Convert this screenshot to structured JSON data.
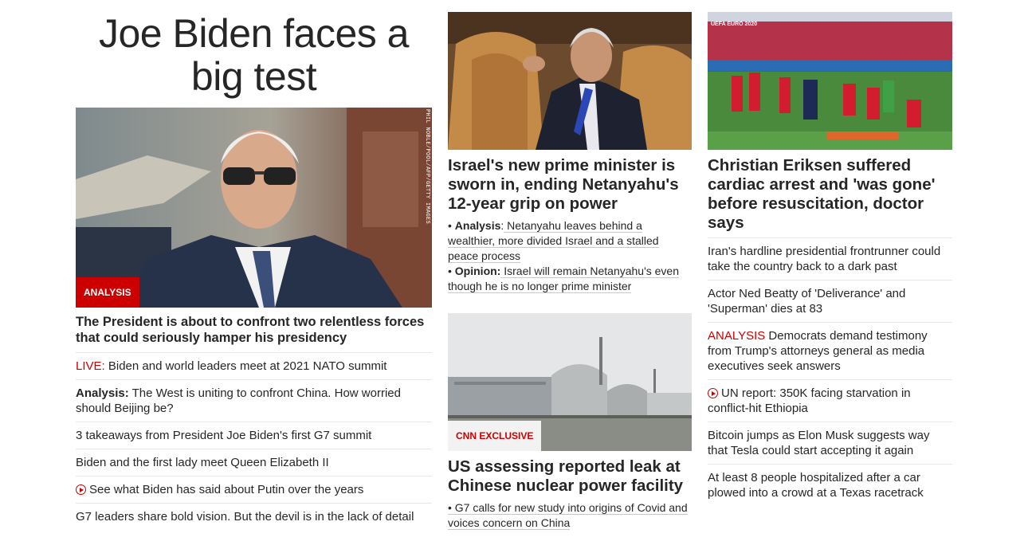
{
  "col1": {
    "big_headline": "Joe Biden faces a big test",
    "image_badge": "ANALYSIS",
    "image_credit": "PHIL NOBLE/POOL/AFP/GETTY IMAGES",
    "lead": "The President is about to confront two relentless forces that could seriously hamper his presidency",
    "items": [
      {
        "kicker": "LIVE:",
        "text": " Biden and world leaders meet at 2021 NATO summit"
      },
      {
        "kicker": "Analysis:",
        "text": " The West is uniting to confront China. How worried should Beijing be?"
      },
      {
        "text": "3 takeaways from President Joe Biden's first G7 summit"
      },
      {
        "text": "Biden and the first lady meet Queen Elizabeth II"
      },
      {
        "text": "See what Biden has said about Putin over the years"
      },
      {
        "text": "G7 leaders share bold vision. But the devil is in the lack of detail"
      }
    ]
  },
  "col2": {
    "story1_headline": "Israel's new prime minister is sworn in, ending Netanyahu's 12-year grip on power",
    "story1_bullets": [
      {
        "label": "Analysis",
        "sep": ":",
        "text": " Netanyahu leaves behind a wealthier, more divided Israel and a stalled peace process"
      },
      {
        "label": "Opinion:",
        "sep": "",
        "text": " Israel will remain Netanyahu's even though he is no longer prime minister"
      }
    ],
    "story2_badge": "CNN EXCLUSIVE",
    "story2_headline": "US assessing reported leak at Chinese nuclear power facility",
    "story2_bullet": "• G7 calls for new study into origins of Covid and voices concern on China"
  },
  "col3": {
    "image_text": "UEFA EURO 2020",
    "headline": "Christian Eriksen suffered cardiac arrest and 'was gone' before resuscitation, doctor says",
    "items": [
      {
        "text": "Iran's hardline presidential frontrunner could take the country back to a dark past"
      },
      {
        "text": "Actor Ned Beatty of 'Deliverance' and 'Superman' dies at 83"
      },
      {
        "kicker": "ANALYSIS",
        "text": " Democrats demand testimony from Trump's attorneys general as media executives seek answers"
      },
      {
        "text": "UN report: 350K facing starvation in conflict-hit Ethiopia"
      },
      {
        "text": "Bitcoin jumps as Elon Musk suggests way that Tesla could start accepting it again"
      },
      {
        "text": "At least 8 people hospitalized after a car plowed into a crowd at a Texas racetrack"
      }
    ]
  },
  "colors": {
    "accent": "#cc0000",
    "text": "#262626",
    "divider": "#e6e6e6"
  }
}
